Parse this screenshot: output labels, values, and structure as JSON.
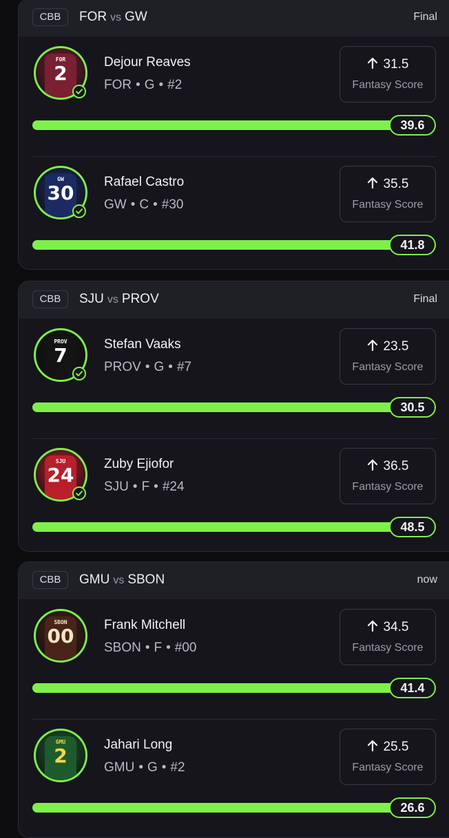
{
  "games": [
    {
      "league": "CBB",
      "team_a": "FOR",
      "vs": "vs",
      "team_b": "GW",
      "status": "Final",
      "players": [
        {
          "name": "Dejour Reaves",
          "team": "FOR",
          "position": "G",
          "number": "#2",
          "jersey_team": "FOR",
          "jersey_number": "2",
          "jersey_color": "#7b1f33",
          "jersey_text_color": "#ffffff",
          "checked": true,
          "direction": "up",
          "line": "31.5",
          "score_label": "Fantasy Score",
          "actual": "39.6",
          "progress": 1.0
        },
        {
          "name": "Rafael Castro",
          "team": "GW",
          "position": "C",
          "number": "#30",
          "jersey_team": "GW",
          "jersey_number": "30",
          "jersey_color": "#1c2a63",
          "jersey_text_color": "#ffffff",
          "checked": true,
          "direction": "up",
          "line": "35.5",
          "score_label": "Fantasy Score",
          "actual": "41.8",
          "progress": 1.0
        }
      ]
    },
    {
      "league": "CBB",
      "team_a": "SJU",
      "vs": "vs",
      "team_b": "PROV",
      "status": "Final",
      "players": [
        {
          "name": "Stefan Vaaks",
          "team": "PROV",
          "position": "G",
          "number": "#7",
          "jersey_team": "PROV",
          "jersey_number": "7",
          "jersey_color": "#141414",
          "jersey_text_color": "#ffffff",
          "checked": true,
          "direction": "up",
          "line": "23.5",
          "score_label": "Fantasy Score",
          "actual": "30.5",
          "progress": 1.0
        },
        {
          "name": "Zuby Ejiofor",
          "team": "SJU",
          "position": "F",
          "number": "#24",
          "jersey_team": "SJU",
          "jersey_number": "24",
          "jersey_color": "#b81f2b",
          "jersey_text_color": "#ffffff",
          "checked": true,
          "direction": "up",
          "line": "36.5",
          "score_label": "Fantasy Score",
          "actual": "48.5",
          "progress": 1.0
        }
      ]
    },
    {
      "league": "CBB",
      "team_a": "GMU",
      "vs": "vs",
      "team_b": "SBON",
      "status": "now",
      "players": [
        {
          "name": "Frank Mitchell",
          "team": "SBON",
          "position": "F",
          "number": "#00",
          "jersey_team": "SBON",
          "jersey_number": "00",
          "jersey_color": "#4a2418",
          "jersey_text_color": "#f3e6c8",
          "checked": false,
          "direction": "up",
          "line": "34.5",
          "score_label": "Fantasy Score",
          "actual": "41.4",
          "progress": 1.0
        },
        {
          "name": "Jahari Long",
          "team": "GMU",
          "position": "G",
          "number": "#2",
          "jersey_team": "GMU",
          "jersey_number": "2",
          "jersey_color": "#1e5b2c",
          "jersey_text_color": "#f5d64a",
          "checked": false,
          "direction": "up",
          "line": "25.5",
          "score_label": "Fantasy Score",
          "actual": "26.6",
          "progress": 1.0
        }
      ]
    }
  ],
  "colors": {
    "accent": "#7ff04a",
    "card": "#15151b",
    "header": "#1f1f26",
    "track": "#2b2b33"
  },
  "icons": {
    "check": "checkmark-icon",
    "arrow": "arrow-up-icon"
  }
}
